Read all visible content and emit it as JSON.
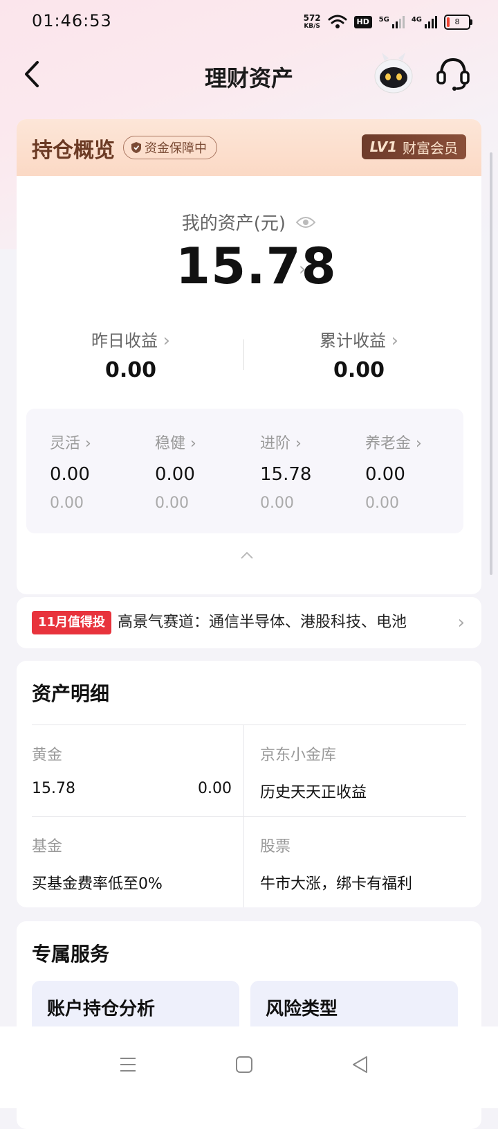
{
  "status_bar": {
    "time": "01:46:53",
    "net_speed_value": "572",
    "net_speed_unit": "KB/S",
    "hd_label": "HD",
    "signal_1": "5G",
    "signal_2": "4G",
    "battery": "8"
  },
  "header": {
    "title": "理财资产"
  },
  "overview": {
    "title": "持仓概览",
    "safety_badge": "资金保障中",
    "vip_level": "LV1",
    "vip_label": "财富会员",
    "asset_label": "我的资产(元)",
    "asset_value": "15.78",
    "yesterday_label": "昨日收益",
    "yesterday_value": "0.00",
    "cumulative_label": "累计收益",
    "cumulative_value": "0.00",
    "categories": [
      {
        "label": "灵活",
        "value": "0.00",
        "sub": "0.00"
      },
      {
        "label": "稳健",
        "value": "0.00",
        "sub": "0.00"
      },
      {
        "label": "进阶",
        "value": "15.78",
        "sub": "0.00"
      },
      {
        "label": "养老金",
        "value": "0.00",
        "sub": "0.00"
      }
    ]
  },
  "promo": {
    "tag": "11月值得投",
    "text": "高景气赛道：通信半导体、港股科技、电池"
  },
  "details": {
    "title": "资产明细",
    "gold_label": "黄金",
    "gold_value": "15.78",
    "gold_income": "0.00",
    "jd_gold_label": "京东小金库",
    "jd_gold_desc": "历史天天正收益",
    "fund_label": "基金",
    "fund_desc": "买基金费率低至0%",
    "stock_label": "股票",
    "stock_desc": "牛市大涨，绑卡有福利"
  },
  "services": {
    "title": "专属服务",
    "items": [
      {
        "label": "账户持仓分析"
      },
      {
        "label": "风险类型"
      }
    ]
  },
  "icons": {
    "back": "chevron-left-icon",
    "robot": "robot-assistant-icon",
    "service": "headset-icon",
    "eye": "eye-icon",
    "collapse": "chevron-up-icon",
    "nav_menu": "menu-icon",
    "nav_home": "square-icon",
    "nav_back": "triangle-back-icon"
  },
  "colors": {
    "accent_red": "#e8333c",
    "vip_brown": "#6e3b2a",
    "overview_header": "#fbd9c5"
  }
}
